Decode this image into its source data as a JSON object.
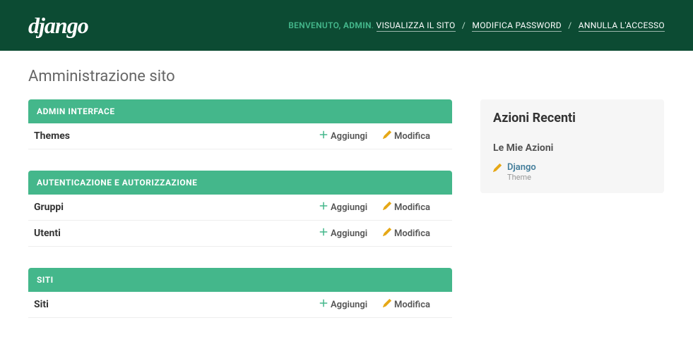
{
  "header": {
    "logo": "django",
    "welcome": "BENVENUTO,",
    "user": "ADMIN",
    "links": {
      "view_site": "VISUALIZZA IL SITO",
      "change_password": "MODIFICA PASSWORD",
      "logout": "ANNULLA L'ACCESSO"
    }
  },
  "page_title": "Amministrazione sito",
  "actions": {
    "add_label": "Aggiungi",
    "change_label": "Modifica"
  },
  "modules": [
    {
      "title": "ADMIN INTERFACE",
      "models": [
        {
          "name": "Themes"
        }
      ]
    },
    {
      "title": "AUTENTICAZIONE E AUTORIZZAZIONE",
      "models": [
        {
          "name": "Gruppi"
        },
        {
          "name": "Utenti"
        }
      ]
    },
    {
      "title": "SITI",
      "models": [
        {
          "name": "Siti"
        }
      ]
    }
  ],
  "sidebar": {
    "title": "Azioni Recenti",
    "subtitle": "Le Mie Azioni",
    "items": [
      {
        "label": "Django",
        "type": "Theme"
      }
    ]
  }
}
